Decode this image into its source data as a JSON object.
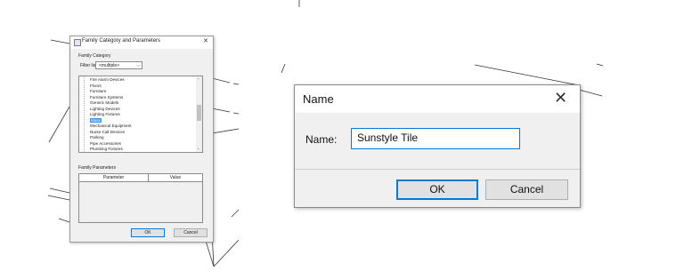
{
  "family_dialog": {
    "title": "Family Category and Parameters",
    "category_section": "Family Category",
    "filter_label": "Filter list:",
    "filter_value": "<multiple>",
    "categories": [
      "Fire Alarm Devices",
      "Floors",
      "Furniture",
      "Furniture Systems",
      "Generic Models",
      "Lighting Devices",
      "Lighting Fixtures",
      "Mass",
      "Mechanical Equipment",
      "Nurse Call Devices",
      "Parking",
      "Pipe Accessories",
      "Plumbing Fixtures"
    ],
    "selected_category": "Mass",
    "parameters_section": "Family Parameters",
    "col_parameter": "Parameter",
    "col_value": "Value",
    "ok_label": "OK",
    "cancel_label": "Cancel"
  },
  "name_dialog": {
    "title": "Name",
    "field_label": "Name:",
    "field_value": "Sunstyle Tile",
    "ok_label": "OK",
    "cancel_label": "Cancel"
  },
  "icons": {
    "close": "close-icon",
    "app": "app-icon",
    "dropdown": "chevron-down-icon"
  },
  "colors": {
    "accent": "#0078d7",
    "selection": "#3399ff",
    "dialog_bg": "#f0f0f0"
  }
}
